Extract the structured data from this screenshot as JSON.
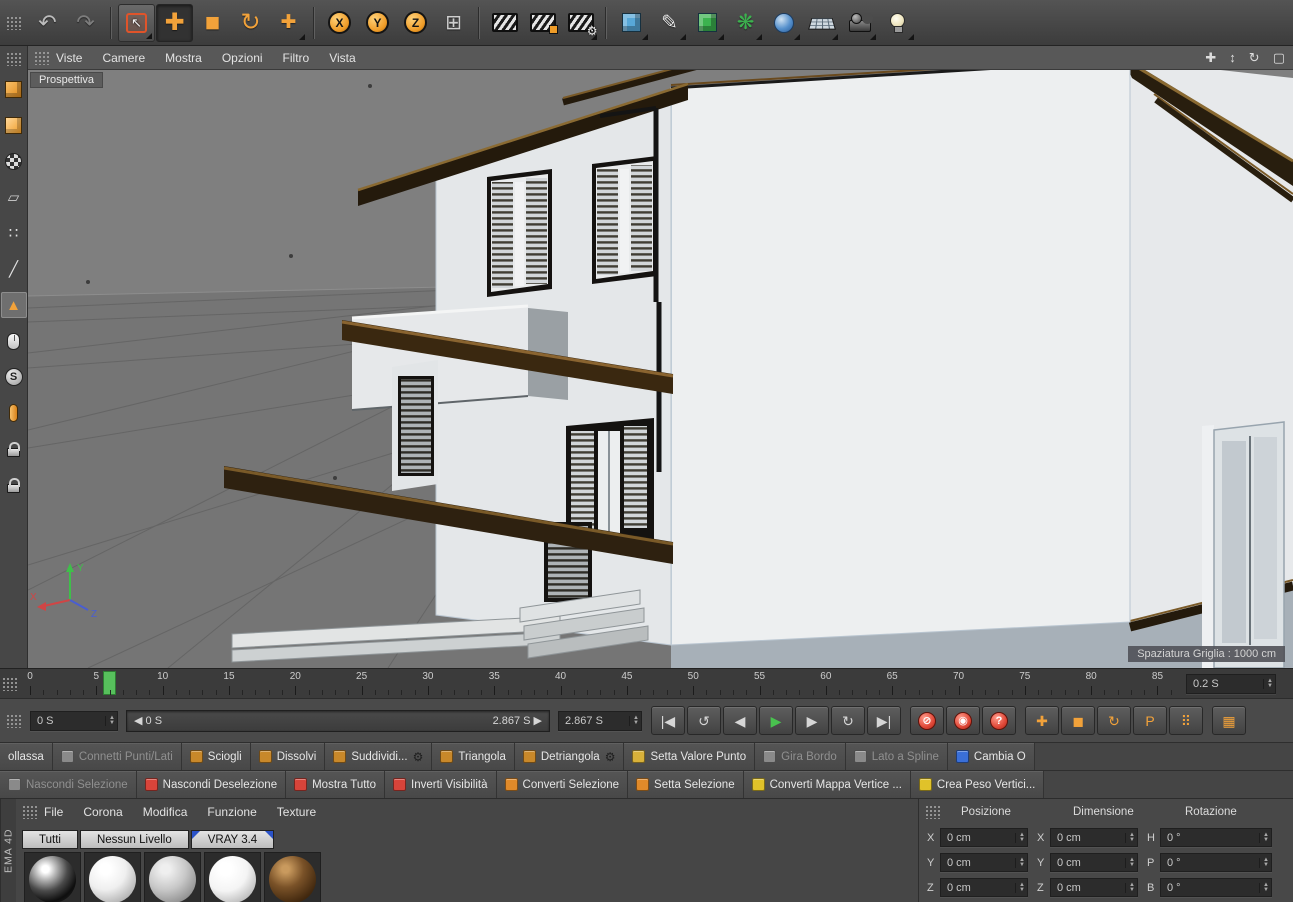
{
  "side_label": "EMA 4D",
  "top_toolbar": {
    "tools": [
      {
        "name": "undo-icon",
        "kind": "glyph",
        "glyph": "↶",
        "color": "#bcbcbc",
        "size": 22
      },
      {
        "name": "redo-icon",
        "kind": "glyph",
        "glyph": "↷",
        "color": "#7d7d7d",
        "size": 22
      },
      {
        "sep": true
      },
      {
        "name": "live-selection-icon",
        "kind": "selection",
        "raised": true,
        "corner": true
      },
      {
        "name": "move-tool-icon",
        "kind": "glyph",
        "glyph": "✚",
        "color": "#f2a23a",
        "size": 24,
        "active": true
      },
      {
        "name": "scale-tool-icon",
        "kind": "glyph",
        "glyph": "◼",
        "color": "#f2a23a",
        "size": 19
      },
      {
        "name": "rotate-tool-icon",
        "kind": "glyph",
        "glyph": "↻",
        "color": "#f2a23a",
        "size": 24
      },
      {
        "name": "last-used-tool-icon",
        "kind": "glyph",
        "glyph": "✚",
        "color": "#f2a23a",
        "size": 19,
        "corner": true
      },
      {
        "sep": true
      },
      {
        "name": "lock-x-axis-icon",
        "kind": "circle-letter",
        "letter": "X"
      },
      {
        "name": "lock-y-axis-icon",
        "kind": "circle-letter",
        "letter": "Y"
      },
      {
        "name": "lock-z-axis-icon",
        "kind": "circle-letter",
        "letter": "Z"
      },
      {
        "name": "coordinate-system-icon",
        "kind": "glyph",
        "glyph": "⊞",
        "color": "#cfcfcf",
        "size": 20
      },
      {
        "sep": true
      },
      {
        "name": "render-view-icon",
        "kind": "clapper",
        "badge": ""
      },
      {
        "name": "render-picture-viewer-icon",
        "kind": "clapper",
        "badge": "square"
      },
      {
        "name": "render-settings-icon",
        "kind": "clapper",
        "badge": "gear",
        "corner": true
      },
      {
        "sep": true
      },
      {
        "name": "add-primitive-cube-icon",
        "kind": "cube",
        "color": "#58a8d8",
        "corner": true
      },
      {
        "name": "add-spline-pen-icon",
        "kind": "glyph",
        "glyph": "✎",
        "color": "#e8e8e8",
        "size": 20,
        "corner": true
      },
      {
        "name": "generators-icon",
        "kind": "cube",
        "color": "#3cb24f",
        "corner": true
      },
      {
        "name": "deformers-icon",
        "kind": "glyph",
        "glyph": "❋",
        "color": "#3cb24f",
        "size": 21,
        "corner": true
      },
      {
        "name": "environment-icon",
        "kind": "blob",
        "corner": true
      },
      {
        "name": "floor-icon",
        "kind": "grid",
        "corner": true
      },
      {
        "name": "camera-icon",
        "kind": "camera",
        "corner": true
      },
      {
        "name": "light-icon",
        "kind": "bulb",
        "corner": true
      }
    ]
  },
  "left_toolbar": {
    "tools": [
      {
        "name": "make-editable-icon",
        "kind": "lcube"
      },
      {
        "name": "model-mode-icon",
        "kind": "lcube2"
      },
      {
        "name": "texture-mode-icon",
        "kind": "checker"
      },
      {
        "name": "workplane-mode-icon",
        "kind": "glyph",
        "glyph": "▱",
        "color": "#cfcfcf"
      },
      {
        "name": "points-mode-icon",
        "kind": "glyph",
        "glyph": "∷",
        "color": "#e0e0e0"
      },
      {
        "name": "edges-mode-icon",
        "kind": "glyph",
        "glyph": "╱",
        "color": "#e0e0e0"
      },
      {
        "name": "polygons-mode-icon",
        "kind": "glyph",
        "glyph": "▲",
        "color": "#f2a23a",
        "active": true
      },
      {
        "name": "animation-mode-icon",
        "kind": "mouse"
      },
      {
        "name": "snap-toggle-icon",
        "kind": "circleS",
        "letter": "S"
      },
      {
        "name": "magnet-tool-icon",
        "kind": "capsule"
      },
      {
        "name": "lock-workplane-icon",
        "kind": "lock"
      },
      {
        "name": "lock-view-icon",
        "kind": "lock"
      }
    ]
  },
  "viewport": {
    "menu": [
      "Viste",
      "Camere",
      "Mostra",
      "Opzioni",
      "Filtro",
      "Vista"
    ],
    "view_controls": [
      {
        "name": "pan-view-icon",
        "glyph": "✚"
      },
      {
        "name": "zoom-view-icon",
        "glyph": "↕"
      },
      {
        "name": "rotate-view-icon",
        "glyph": "↻"
      },
      {
        "name": "toggle-view-icon",
        "glyph": "▢"
      }
    ],
    "view_label": "Prospettiva",
    "grid_label": "Spaziatura Griglia : 1000 cm",
    "axes": {
      "x": "X",
      "y": "Y",
      "z": "Z"
    }
  },
  "timeline": {
    "labels": [
      "0",
      "5",
      "10",
      "15",
      "20",
      "25",
      "30",
      "35",
      "40",
      "45",
      "50",
      "55",
      "60",
      "65",
      "70",
      "75",
      "80",
      "85"
    ],
    "max_frame": 86,
    "current_frame": 6,
    "zoom_value": "0.2 S"
  },
  "transport": {
    "current_time": "0 S",
    "range_start_label": "◀ 0 S",
    "range_end_label": "2.867 S ▶",
    "duration": "2.867 S",
    "play_buttons": [
      {
        "name": "goto-start-button",
        "glyph": "|◀"
      },
      {
        "name": "play-backward-button",
        "glyph": "↺"
      },
      {
        "name": "previous-frame-button",
        "glyph": "◀"
      },
      {
        "name": "play-forward-button",
        "glyph": "▶",
        "color": "#49c24f"
      },
      {
        "name": "next-frame-button",
        "glyph": "▶"
      },
      {
        "name": "play-loop-button",
        "glyph": "↻"
      },
      {
        "name": "goto-end-button",
        "glyph": "▶|"
      }
    ],
    "record_buttons": [
      {
        "name": "record-keyframe-button",
        "glyph": "⊘"
      },
      {
        "name": "autokey-button",
        "glyph": "◉"
      },
      {
        "name": "keying-help-button",
        "glyph": "?"
      }
    ],
    "key_buttons": [
      {
        "name": "key-position-button",
        "glyph": "✚"
      },
      {
        "name": "key-scale-button",
        "glyph": "◼"
      },
      {
        "name": "key-rotation-button",
        "glyph": "↻"
      },
      {
        "name": "key-parameter-button",
        "glyph": "P"
      },
      {
        "name": "key-pla-button",
        "glyph": "⠿"
      }
    ],
    "extra_button": {
      "name": "keyframe-selection-button",
      "glyph": "▦"
    }
  },
  "mesh_commands": [
    {
      "label": "ollassa",
      "enabled": true
    },
    {
      "label": "Connetti Punti/Lati",
      "enabled": false,
      "icon": "#8a8a8a"
    },
    {
      "label": "Sciogli",
      "enabled": true,
      "icon": "#c8882a"
    },
    {
      "label": "Dissolvi",
      "enabled": true,
      "icon": "#c8882a"
    },
    {
      "label": "Suddividi...",
      "enabled": true,
      "icon": "#c8882a",
      "gear": true
    },
    {
      "label": "Triangola",
      "enabled": true,
      "icon": "#c8882a"
    },
    {
      "label": "Detriangola",
      "enabled": true,
      "icon": "#c8882a",
      "gear": true
    },
    {
      "label": "Setta Valore Punto",
      "enabled": true,
      "icon": "#d8b13a"
    },
    {
      "label": "Gira Bordo",
      "enabled": false,
      "icon": "#8a8a8a"
    },
    {
      "label": "Lato a Spline",
      "enabled": false,
      "icon": "#8a8a8a"
    },
    {
      "label": "Cambia O",
      "enabled": true,
      "icon": "#3a6fd8"
    }
  ],
  "visibility_commands": [
    {
      "label": "Nascondi Selezione",
      "enabled": false,
      "icon": "#8a8a8a"
    },
    {
      "label": "Nascondi Deselezione",
      "enabled": true,
      "icon": "#d8443a"
    },
    {
      "label": "Mostra Tutto",
      "enabled": true,
      "icon": "#d8443a"
    },
    {
      "label": "Inverti Visibilità",
      "enabled": true,
      "icon": "#d8443a"
    },
    {
      "label": "Converti Selezione",
      "enabled": true,
      "icon": "#e08a2a"
    },
    {
      "label": "Setta Selezione",
      "enabled": true,
      "icon": "#e08a2a"
    },
    {
      "label": "Converti Mappa Vertice ...",
      "enabled": true,
      "icon": "#e0c22a"
    },
    {
      "label": "Crea Peso Vertici...",
      "enabled": true,
      "icon": "#e0c22a"
    }
  ],
  "materials": {
    "menu": [
      "File",
      "Corona",
      "Modifica",
      "Funzione",
      "Texture"
    ],
    "tabs": [
      {
        "label": "Tutti"
      },
      {
        "label": "Nessun Livello"
      },
      {
        "label": "VRAY 3.4",
        "accent": true
      }
    ],
    "thumbnails": [
      {
        "name": "material-thumbnail-1",
        "kind": "chrome"
      },
      {
        "name": "material-thumbnail-2",
        "kind": "white"
      },
      {
        "name": "material-thumbnail-3",
        "kind": "gray"
      },
      {
        "name": "material-thumbnail-4",
        "kind": "white2"
      },
      {
        "name": "material-thumbnail-5",
        "kind": "brown"
      }
    ]
  },
  "coordinates": {
    "columns": [
      "Posizione",
      "Dimensione",
      "Rotazione"
    ],
    "rows": [
      {
        "cells": [
          {
            "label": "X",
            "value": "0 cm"
          },
          {
            "label": "X",
            "value": "0 cm"
          },
          {
            "label": "H",
            "value": "0 °"
          }
        ]
      },
      {
        "cells": [
          {
            "label": "Y",
            "value": "0 cm"
          },
          {
            "label": "Y",
            "value": "0 cm"
          },
          {
            "label": "P",
            "value": "0 °"
          }
        ]
      },
      {
        "cells": [
          {
            "label": "Z",
            "value": "0 cm"
          },
          {
            "label": "Z",
            "value": "0 cm"
          },
          {
            "label": "B",
            "value": "0 °"
          }
        ]
      }
    ]
  }
}
